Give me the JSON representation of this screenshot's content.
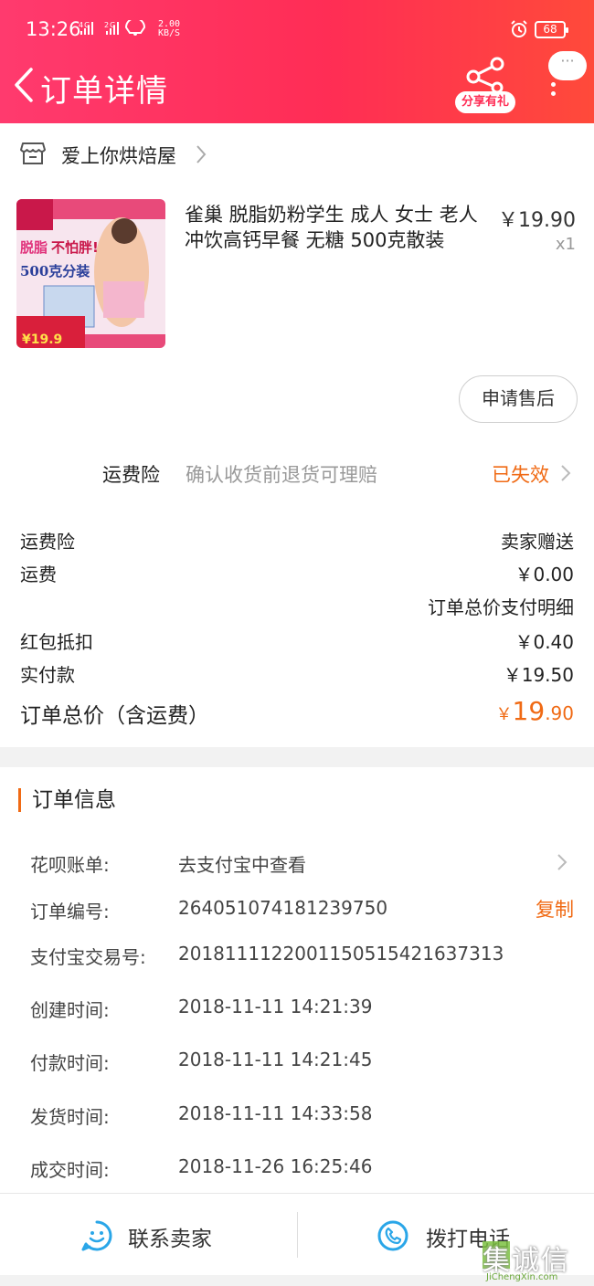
{
  "status_bar": {
    "time": "13:26",
    "network": "4G 2G",
    "speed": "2.00\nKB/S",
    "battery": "68"
  },
  "header": {
    "title": "订单详情",
    "share_label": "分享有礼",
    "message_bubble": "···"
  },
  "shop": {
    "name": "爱上你烘焙屋"
  },
  "product": {
    "title": "雀巢 脱脂奶粉学生 成人 女士 老人 冲饮高钙早餐 无糖 500克散装",
    "price": "￥19.90",
    "qty": "x1",
    "image_text": {
      "headline1": "脱脂",
      "headline2": "不怕胖!",
      "headline3": "500克分装",
      "promo": "¥19.9"
    }
  },
  "after_sale_button": "申请售后",
  "insurance": {
    "title": "运费险",
    "desc": "确认收货前退货可理赔",
    "status": "已失效"
  },
  "fees": {
    "ins_label": "运费险",
    "ins_value": "卖家赠送",
    "ship_label": "运费",
    "ship_value": "￥0.00",
    "detail_link": "订单总价支付明细",
    "redpack_label": "红包抵扣",
    "redpack_value": "￥0.40",
    "paid_label": "实付款",
    "paid_value": "￥19.50",
    "total_label": "订单总价（含运费）",
    "total_currency": "￥",
    "total_int": "19",
    "total_dec": ".90"
  },
  "order_info": {
    "title": "订单信息",
    "huabei_label": "花呗账单:",
    "huabei_value": "去支付宝中查看",
    "order_no_label": "订单编号:",
    "order_no_value": "264051074181239750",
    "copy_label": "复制",
    "alipay_label": "支付宝交易号:",
    "alipay_value": "2018111122001150515421637313",
    "created_label": "创建时间:",
    "created_value": "2018-11-11 14:21:39",
    "paid_label": "付款时间:",
    "paid_value": "2018-11-11 14:21:45",
    "shipped_label": "发货时间:",
    "shipped_value": "2018-11-11 14:33:58",
    "done_label": "成交时间:",
    "done_value": "2018-11-26 16:25:46"
  },
  "bottom": {
    "contact_label": "联系卖家",
    "call_label": "拨打电话"
  },
  "watermark": {
    "logo": "集诚信",
    "url": "JiChengXin.com"
  },
  "colors": {
    "header_gradient_start": "#ff3a6e",
    "header_gradient_end": "#ff4a3a",
    "accent_orange": "#f06a14",
    "icon_blue": "#2aa6e8"
  }
}
